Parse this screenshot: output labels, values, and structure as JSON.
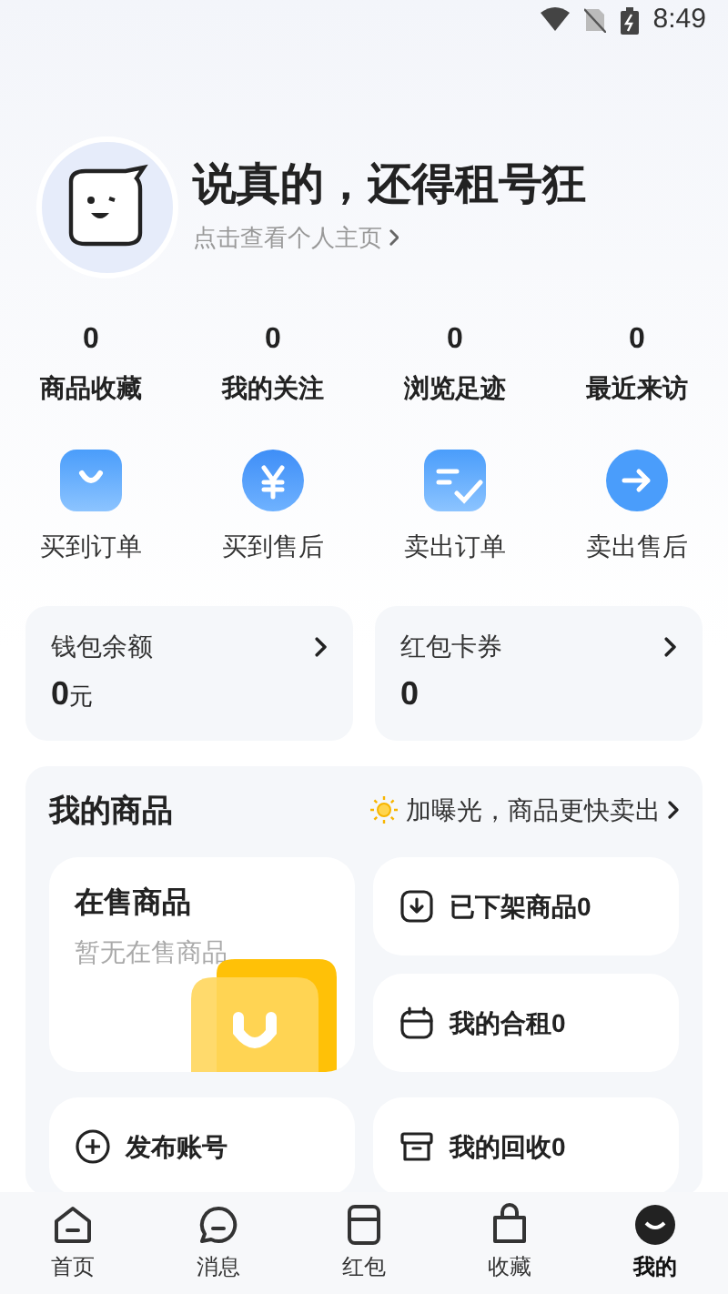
{
  "status_bar": {
    "time": "8:49"
  },
  "profile": {
    "name": "说真的，还得租号狂",
    "link": "点击查看个人主页"
  },
  "stats": [
    {
      "value": "0",
      "label": "商品收藏"
    },
    {
      "value": "0",
      "label": "我的关注"
    },
    {
      "value": "0",
      "label": "浏览足迹"
    },
    {
      "value": "0",
      "label": "最近来访"
    }
  ],
  "shortcuts": [
    {
      "kind": "bag",
      "label": "买到订单"
    },
    {
      "kind": "yen",
      "label": "买到售后"
    },
    {
      "kind": "list",
      "label": "卖出订单"
    },
    {
      "kind": "arrow",
      "label": "卖出售后"
    }
  ],
  "balances": [
    {
      "title": "钱包余额",
      "value": "0",
      "unit": "元"
    },
    {
      "title": "红包卡券",
      "value": "0"
    }
  ],
  "my_goods": {
    "title": "我的商品",
    "promo": "加曝光，商品更快卖出",
    "on_sale": {
      "title": "在售商品",
      "subtitle": "暂无在售商品"
    },
    "publish": "发布账号",
    "items": [
      {
        "kind": "download",
        "label": "已下架商品0"
      },
      {
        "kind": "calendar",
        "label": "我的合租0"
      },
      {
        "kind": "box",
        "label": "我的回收0"
      }
    ]
  },
  "tabs": [
    {
      "kind": "home",
      "label": "首页",
      "selected": false
    },
    {
      "kind": "chat",
      "label": "消息",
      "selected": false
    },
    {
      "kind": "wallet",
      "label": "红包",
      "selected": false
    },
    {
      "kind": "bag",
      "label": "收藏",
      "selected": false
    },
    {
      "kind": "avatar",
      "label": "我的",
      "selected": true
    }
  ]
}
